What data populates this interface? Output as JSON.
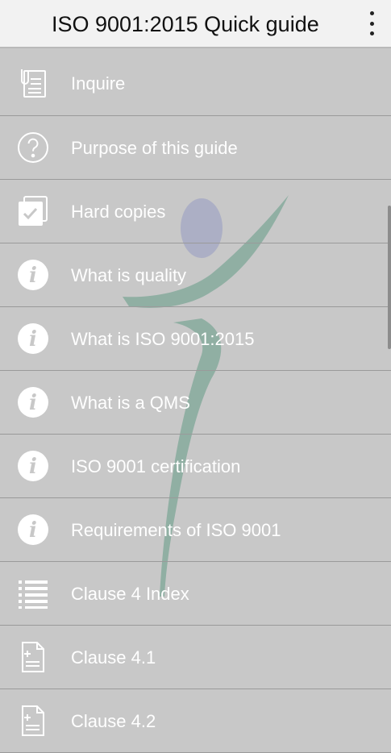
{
  "app": {
    "title": "ISO 9001:2015 Quick guide",
    "overflow_icon": "more-vert-icon"
  },
  "menu": {
    "items": [
      {
        "label": "Inquire",
        "icon": "inquire-document-icon"
      },
      {
        "label": "Purpose of this guide",
        "icon": "question-circle-icon"
      },
      {
        "label": "Hard copies",
        "icon": "checkbox-copies-icon"
      },
      {
        "label": "What is quality",
        "icon": "info-circle-icon"
      },
      {
        "label": "What is ISO 9001:2015",
        "icon": "info-circle-icon"
      },
      {
        "label": "What is a QMS",
        "icon": "info-circle-icon"
      },
      {
        "label": "ISO 9001 certification",
        "icon": "info-circle-icon"
      },
      {
        "label": "Requirements of ISO 9001",
        "icon": "info-circle-icon"
      },
      {
        "label": "Clause 4 Index",
        "icon": "list-icon"
      },
      {
        "label": "Clause 4.1",
        "icon": "document-plus-icon"
      },
      {
        "label": "Clause 4.2",
        "icon": "document-plus-icon"
      }
    ]
  },
  "colors": {
    "background": "#c8c8c8",
    "appbar": "#f2f2f2",
    "label_text": "#ffffff",
    "watermark_head": "#a7aac4",
    "watermark_body": "#86aa9c"
  }
}
